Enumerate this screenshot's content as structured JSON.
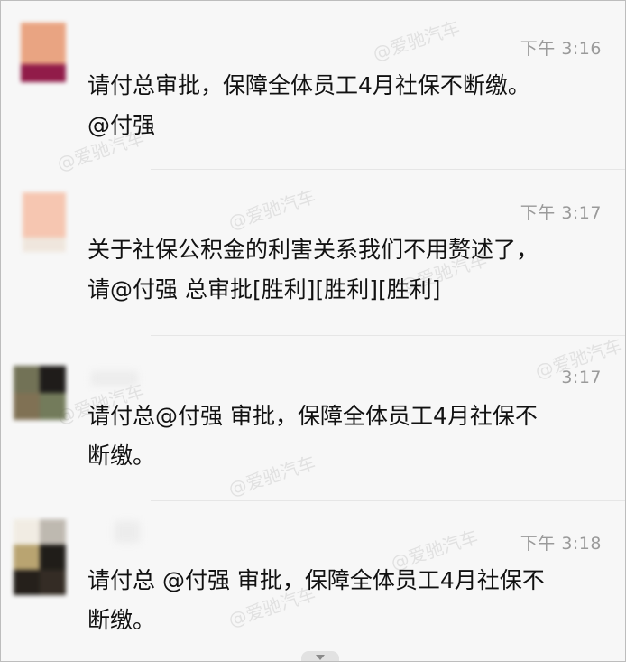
{
  "messages": [
    {
      "time": "下午 3:16",
      "lines": [
        "请付总审批，保障全体员工4月社保不断缴。",
        "@付强"
      ]
    },
    {
      "time": "下午 3:17",
      "lines": [
        "关于社保公积金的利害关系我们不用赘述了，",
        "请@付强  总审批[胜利][胜利][胜利]"
      ]
    },
    {
      "time": "3:17",
      "lines": [
        "请付总@付强 审批，保障全体员工4月社保不",
        "断缴。"
      ]
    },
    {
      "time": "下午 3:18",
      "lines": [
        "请付总 @付强 审批，保障全体员工4月社保不",
        "断缴。"
      ]
    }
  ],
  "watermark": "@爱驰汽车",
  "colors": {
    "background": "#f7f7f7",
    "timestamp": "#9a9a9a",
    "text": "#111111"
  }
}
